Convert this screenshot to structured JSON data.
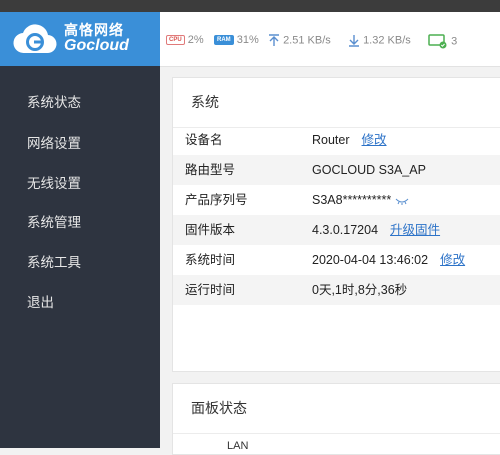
{
  "brand": {
    "name_cn": "高恪网络",
    "name_en": "Gocloud",
    "color": "#3a8fd8"
  },
  "status_bar": {
    "cpu_label": "CPU",
    "cpu": "2%",
    "ram_label": "RAM",
    "ram": "31%",
    "upload": "2.51 KB/s",
    "download": "1.32 KB/s",
    "clients": "3"
  },
  "sidebar": {
    "items": [
      "系统状态",
      "网络设置",
      "无线设置",
      "系统管理",
      "系统工具",
      "退出"
    ]
  },
  "system_panel": {
    "title": "系统",
    "rows": [
      {
        "key": "设备名",
        "value": "Router",
        "link": "修改"
      },
      {
        "key": "路由型号",
        "value": "GOCLOUD S3A_AP"
      },
      {
        "key": "产品序列号",
        "value": "S3A8**********"
      },
      {
        "key": "固件版本",
        "value": "4.3.0.17204",
        "link": "升级固件"
      },
      {
        "key": "系统时间",
        "value": "2020-04-04 13:46:02",
        "link": "修改"
      },
      {
        "key": "运行时间",
        "value": "0天,1时,8分,36秒"
      }
    ]
  },
  "board_panel": {
    "title": "面板状态",
    "port_label": "LAN"
  }
}
